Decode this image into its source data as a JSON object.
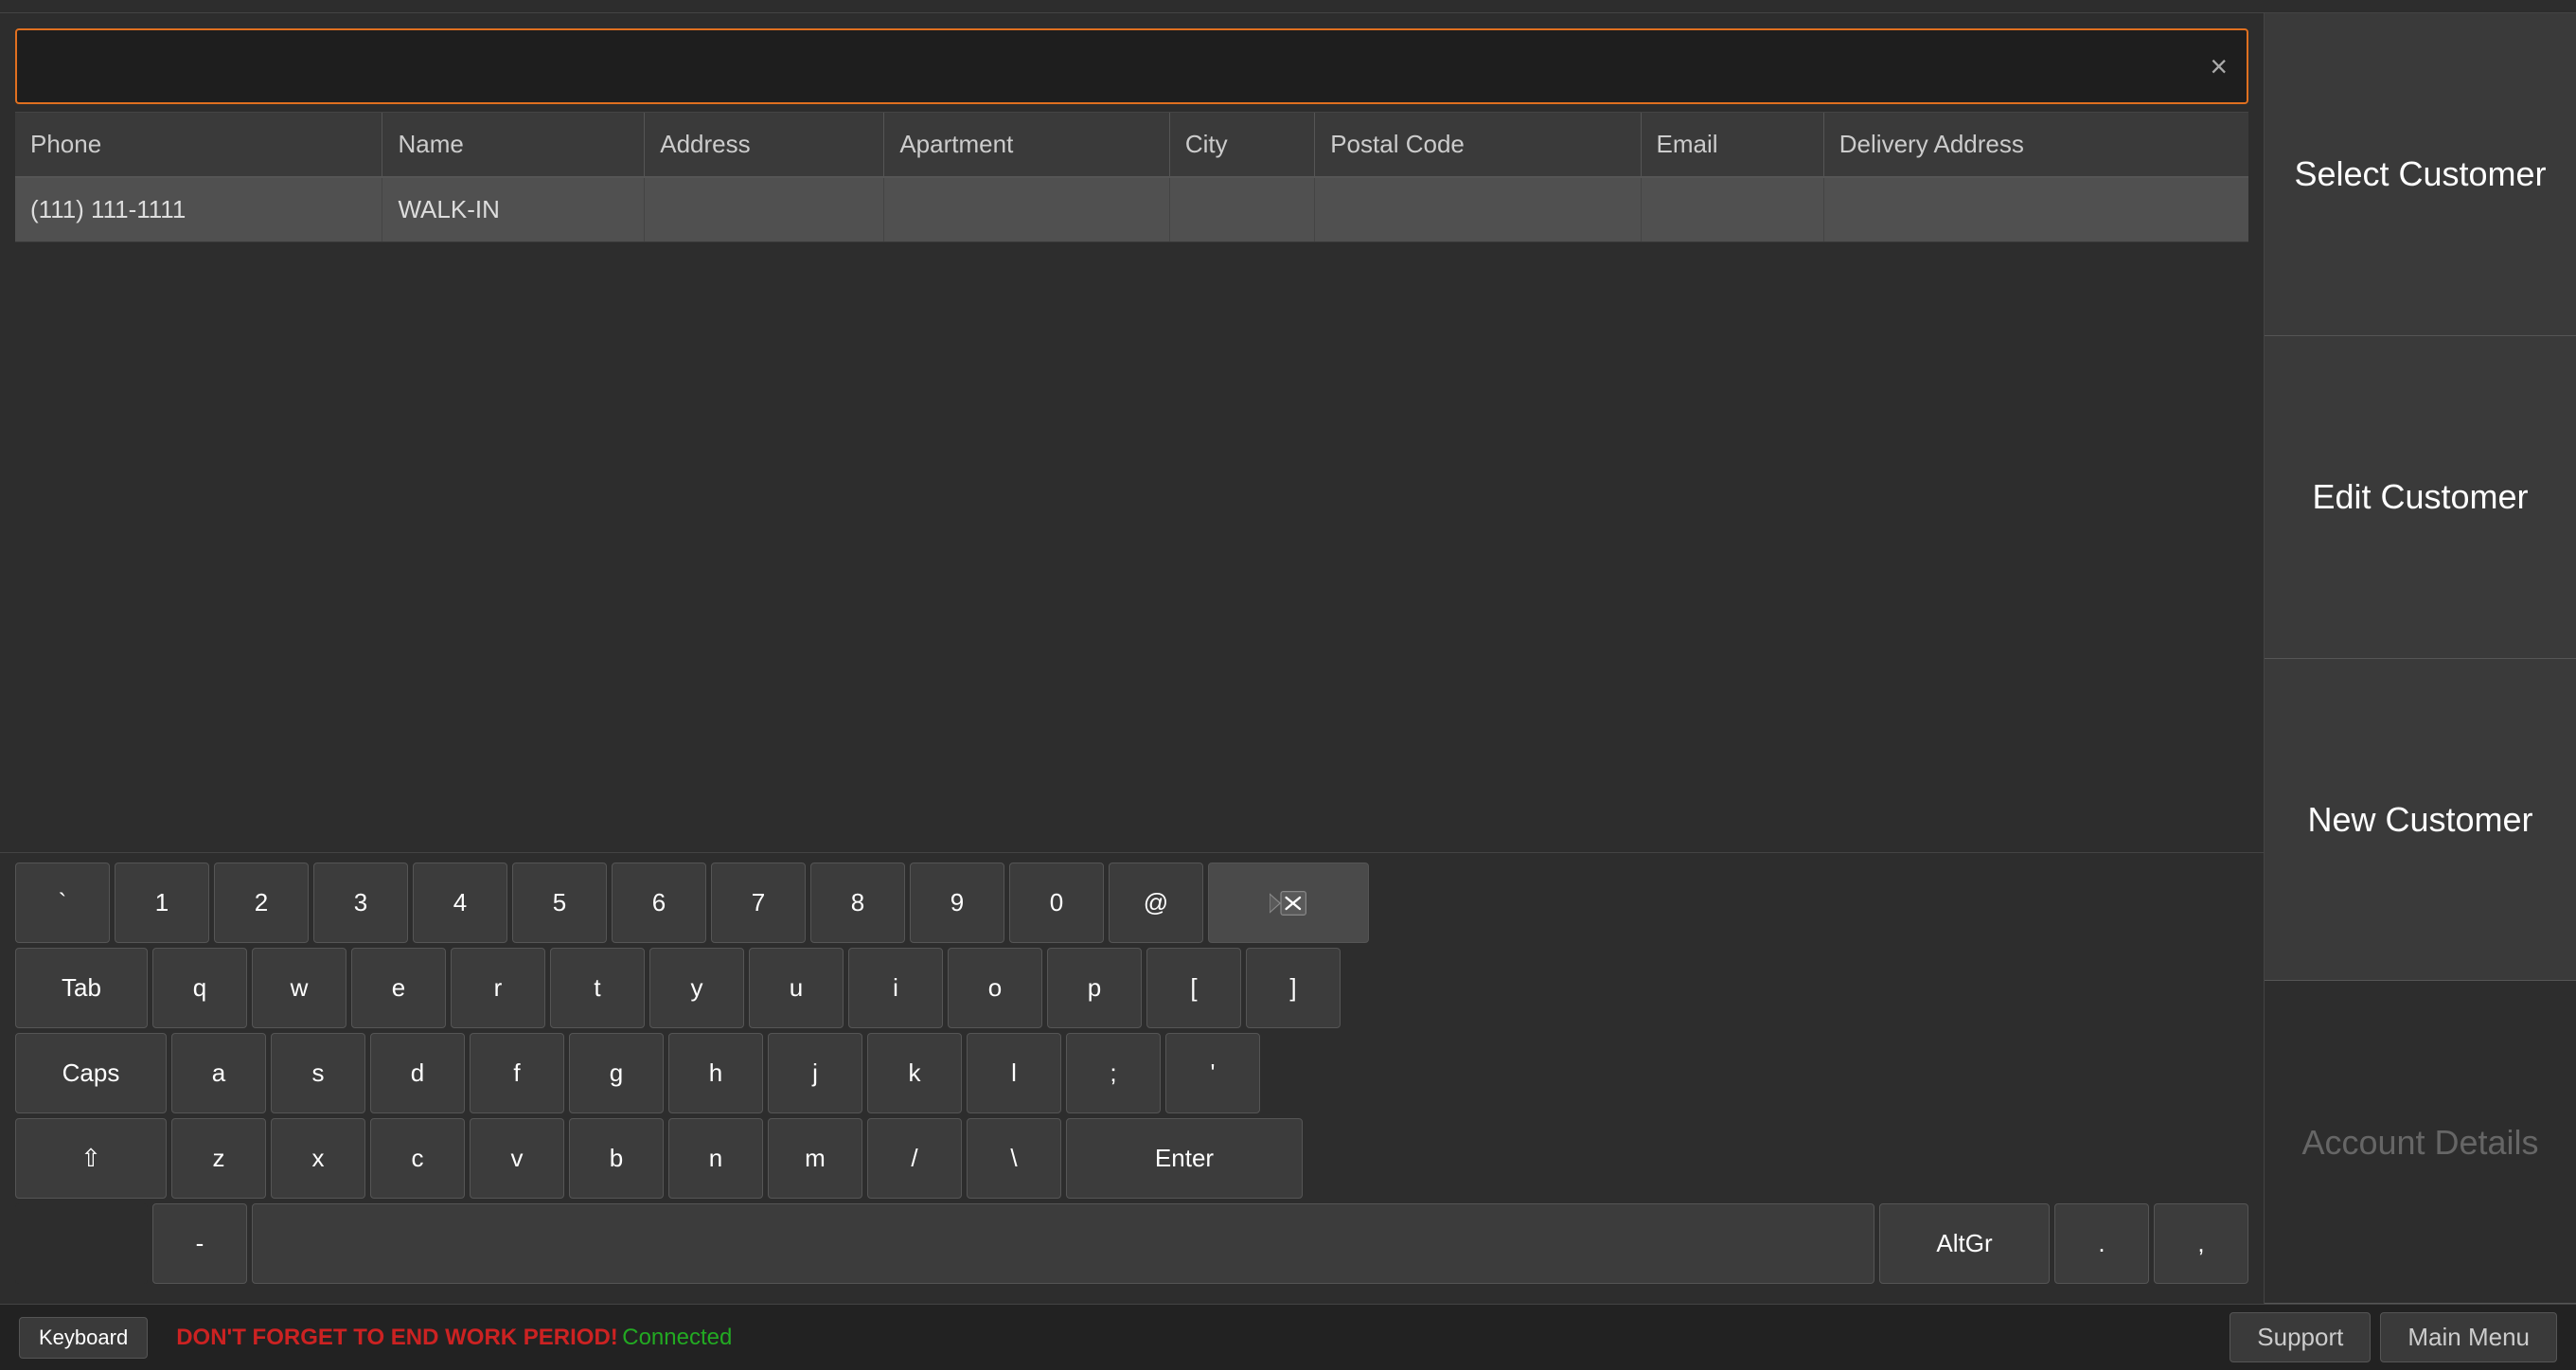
{
  "search": {
    "placeholder": "",
    "clear_label": "×"
  },
  "table": {
    "columns": [
      "Phone",
      "Name",
      "Address",
      "Apartment",
      "City",
      "Postal Code",
      "Email",
      "Delivery Address"
    ],
    "rows": [
      {
        "phone": "(111) 111-1111",
        "name": "WALK-IN",
        "address": "",
        "apartment": "",
        "city": "",
        "postal_code": "",
        "email": "",
        "delivery_address": "",
        "selected": true
      }
    ]
  },
  "keyboard": {
    "rows": [
      {
        "keys": [
          {
            "label": "`",
            "type": "normal"
          },
          {
            "label": "1",
            "type": "normal"
          },
          {
            "label": "2",
            "type": "normal"
          },
          {
            "label": "3",
            "type": "normal"
          },
          {
            "label": "4",
            "type": "normal"
          },
          {
            "label": "5",
            "type": "normal"
          },
          {
            "label": "6",
            "type": "normal"
          },
          {
            "label": "7",
            "type": "normal"
          },
          {
            "label": "8",
            "type": "normal"
          },
          {
            "label": "9",
            "type": "normal"
          },
          {
            "label": "0",
            "type": "normal"
          },
          {
            "label": "@",
            "type": "normal"
          },
          {
            "label": "⌫",
            "type": "backspace"
          }
        ]
      },
      {
        "keys": [
          {
            "label": "Tab",
            "type": "tab"
          },
          {
            "label": "q",
            "type": "normal"
          },
          {
            "label": "w",
            "type": "normal"
          },
          {
            "label": "e",
            "type": "normal"
          },
          {
            "label": "r",
            "type": "normal"
          },
          {
            "label": "t",
            "type": "normal"
          },
          {
            "label": "y",
            "type": "normal"
          },
          {
            "label": "u",
            "type": "normal"
          },
          {
            "label": "i",
            "type": "normal"
          },
          {
            "label": "o",
            "type": "normal"
          },
          {
            "label": "p",
            "type": "normal"
          },
          {
            "label": "[",
            "type": "normal"
          },
          {
            "label": "]",
            "type": "normal"
          }
        ]
      },
      {
        "keys": [
          {
            "label": "Caps",
            "type": "caps"
          },
          {
            "label": "a",
            "type": "normal"
          },
          {
            "label": "s",
            "type": "normal"
          },
          {
            "label": "d",
            "type": "normal"
          },
          {
            "label": "f",
            "type": "normal"
          },
          {
            "label": "g",
            "type": "normal"
          },
          {
            "label": "h",
            "type": "normal"
          },
          {
            "label": "j",
            "type": "normal"
          },
          {
            "label": "k",
            "type": "normal"
          },
          {
            "label": "l",
            "type": "normal"
          },
          {
            "label": ";",
            "type": "normal"
          },
          {
            "label": "'",
            "type": "normal"
          }
        ]
      },
      {
        "keys": [
          {
            "label": "⇧",
            "type": "shift"
          },
          {
            "label": "z",
            "type": "normal"
          },
          {
            "label": "x",
            "type": "normal"
          },
          {
            "label": "c",
            "type": "normal"
          },
          {
            "label": "v",
            "type": "normal"
          },
          {
            "label": "b",
            "type": "normal"
          },
          {
            "label": "n",
            "type": "normal"
          },
          {
            "label": "m",
            "type": "normal"
          },
          {
            "label": "/",
            "type": "normal"
          },
          {
            "label": "\\",
            "type": "normal"
          },
          {
            "label": "Enter",
            "type": "enter"
          }
        ]
      },
      {
        "keys": [
          {
            "label": "",
            "type": "bottom-left"
          },
          {
            "label": "-",
            "type": "normal"
          },
          {
            "label": "",
            "type": "space"
          },
          {
            "label": "AltGr",
            "type": "altgr"
          },
          {
            "label": ".",
            "type": "normal"
          },
          {
            "label": ",",
            "type": "normal"
          }
        ]
      }
    ]
  },
  "sidebar": {
    "buttons": [
      {
        "label": "Select Customer",
        "disabled": false
      },
      {
        "label": "Edit Customer",
        "disabled": false
      },
      {
        "label": "New Customer",
        "disabled": false
      },
      {
        "label": "Account Details",
        "disabled": true
      }
    ]
  },
  "bottom_bar": {
    "keyboard_label": "Keyboard",
    "warning_text": "DON'T FORGET TO END WORK PERIOD!",
    "connected_text": "Connected",
    "support_label": "Support",
    "main_menu_label": "Main Menu"
  }
}
